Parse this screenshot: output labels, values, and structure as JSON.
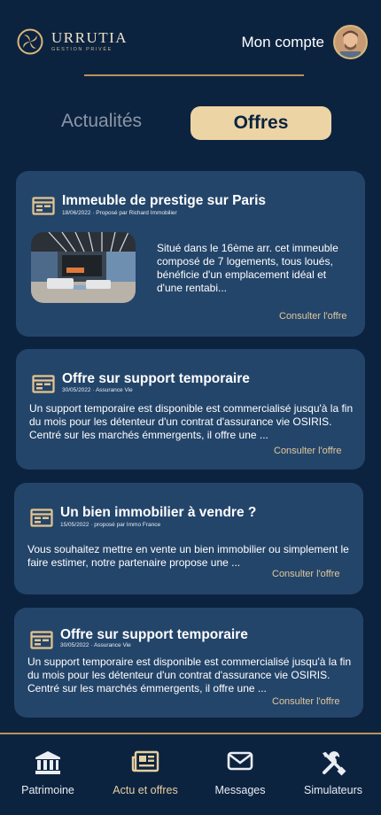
{
  "header": {
    "brand_name": "URRUTIA",
    "brand_sub": "GESTION PRIVÉE",
    "account_label": "Mon compte"
  },
  "tabs": {
    "news": "Actualités",
    "offers": "Offres"
  },
  "cards": [
    {
      "title": "Immeuble de prestige sur Paris",
      "meta": "18/06/2022  · Proposé par Richard Immobilier",
      "body": "Situé dans le 16ème arr. cet immeuble composé de 7 logements, tous loués, bénéficie d'un emplacement idéal et d'une rentabi...",
      "link": "Consulter l'offre"
    },
    {
      "title": "Offre sur support temporaire",
      "meta": "30/05/2022  · Assurance Vie",
      "body": "Un support temporaire est disponible est commercialisé jusqu'à la fin du mois pour les détenteur d'un contrat d'assurance vie OSIRIS. Centré sur les marchés émmergents, il offre une ...",
      "link": "Consulter l'offre"
    },
    {
      "title": "Un bien immobilier à vendre ?",
      "meta": "15/05/2022  · proposé par Immo France",
      "body": "Vous souhaitez mettre en vente un bien immobilier ou simplement le faire estimer, notre partenaire propose une ...",
      "link": "Consulter l'offre"
    },
    {
      "title": "Offre sur support temporaire",
      "meta": "30/05/2022  · Assurance Vie",
      "body": "Un support temporaire est disponible est commercialisé jusqu'à la fin du mois pour les détenteur d'un contrat d'assurance vie OSIRIS. Centré sur les marchés émmergents, il offre une ...",
      "link": "Consulter l'offre"
    }
  ],
  "nav": {
    "patrimoine": "Patrimoine",
    "actu": "Actu et offres",
    "messages": "Messages",
    "simulateurs": "Simulateurs"
  },
  "colors": {
    "background": "#0c2340",
    "card": "#24456a",
    "accent": "#ecd4a5",
    "link": "#e0c89b"
  }
}
